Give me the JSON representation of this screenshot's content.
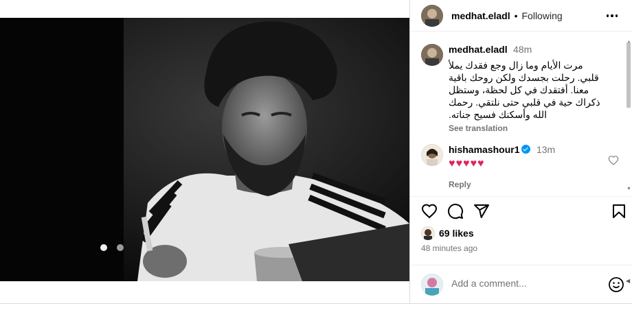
{
  "header": {
    "username": "medhat.eladl",
    "separator": "•",
    "follow_status": "Following"
  },
  "caption": {
    "username": "medhat.eladl",
    "time": "48m",
    "text": "مرت الأيام وما زال وجع فقدك يملأ قلبي. رحلت بجسدك ولكن روحك باقية معنا. أفتقدك في كل لحظة، وستظل ذكراك حية في قلبي حتى نلتقي. رحمك الله وأسكنك فسيح جناته.",
    "see_translation": "See translation"
  },
  "comment": {
    "username": "hishamashour1",
    "time": "13m",
    "text": "♥♥♥♥♥",
    "reply": "Reply"
  },
  "post": {
    "likes": "69 likes",
    "posted": "48 minutes ago"
  },
  "add_comment": {
    "placeholder": "Add a comment..."
  },
  "carousel": {
    "slides": 2,
    "active": 1
  },
  "icons": {
    "like": "heart-icon",
    "comment": "comment-icon",
    "share": "share-icon",
    "save": "bookmark-icon",
    "emoji": "emoji-icon",
    "more": "more-options-icon"
  },
  "colors": {
    "accent": "#0095f6",
    "heart": "#e0245e",
    "muted": "#737373"
  }
}
